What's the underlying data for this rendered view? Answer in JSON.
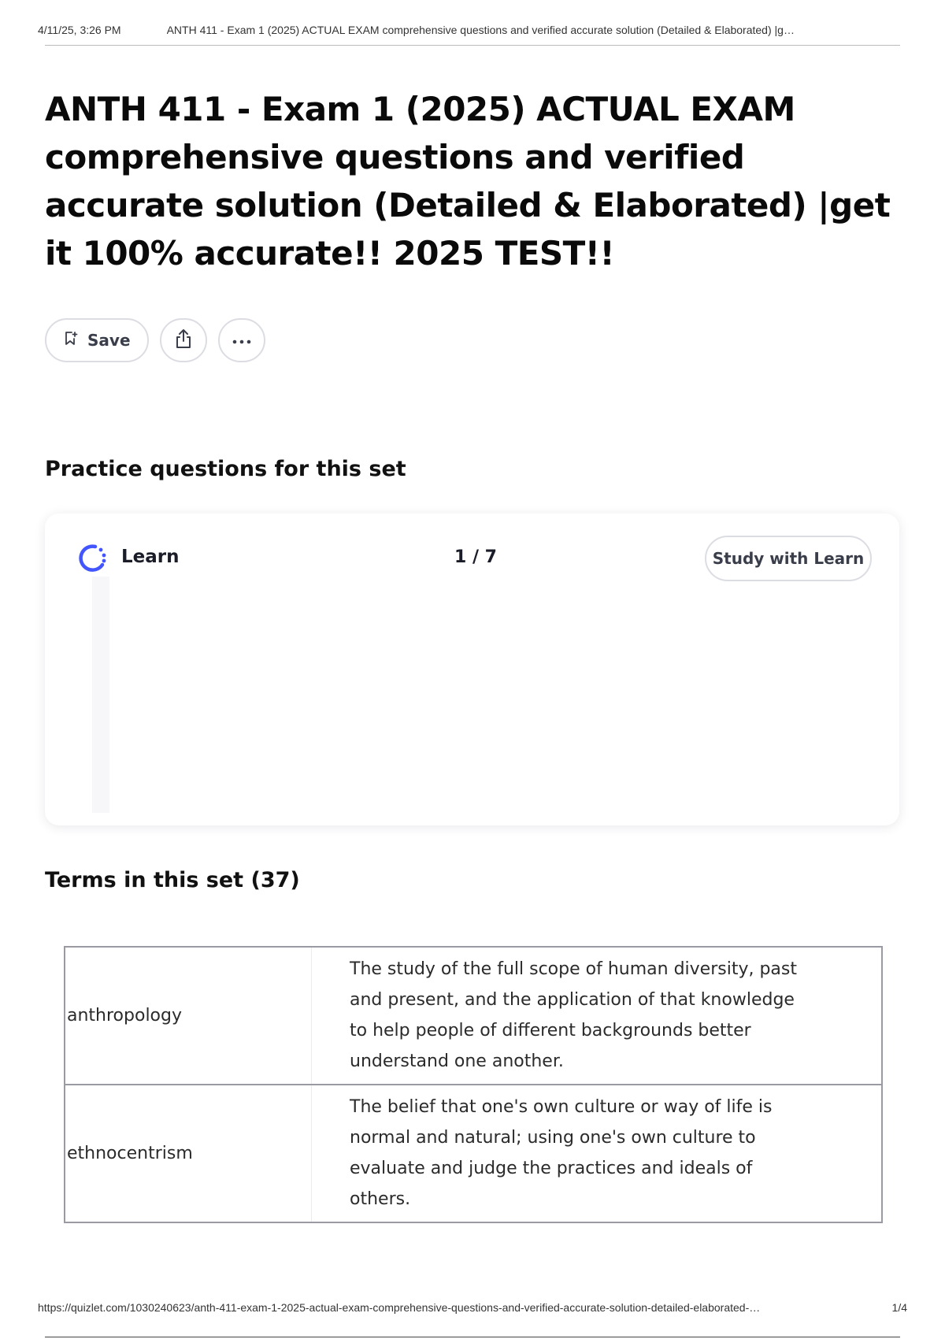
{
  "print_header": {
    "datetime": "4/11/25, 3:26 PM",
    "doc_title": "ANTH 411 - Exam 1 (2025) ACTUAL EXAM comprehensive questions and verified accurate solution (Detailed & Elaborated) |g…"
  },
  "page": {
    "title": "ANTH 411 - Exam 1 (2025) ACTUAL EXAM comprehensive questions and verified accurate solution (Detailed & Elaborated) |get it 100% accurate!! 2025 TEST!!"
  },
  "actions": {
    "save_label": "Save",
    "save_icon": "bookmark-icon",
    "share_icon": "share-icon",
    "more_icon": "more-icon"
  },
  "practice": {
    "heading": "Practice questions for this set",
    "mode_label": "Learn",
    "progress": "1 / 7",
    "cta_label": "Study with Learn"
  },
  "terms": {
    "heading": "Terms in this set (37)",
    "rows": [
      {
        "term": "anthropology",
        "definition": "The study of the full scope of human diversity, past and present, and the application of that knowledge to help people of different backgrounds better understand one another."
      },
      {
        "term": "ethnocentrism",
        "definition": "The belief that one's own culture or way of life is normal and natural; using one's own culture to evaluate and judge the practices and ideals of others."
      }
    ]
  },
  "print_footer": {
    "url": "https://quizlet.com/1030240623/anth-411-exam-1-2025-actual-exam-comprehensive-questions-and-verified-accurate-solution-detailed-elaborated-…",
    "page_number": "1/4"
  },
  "colors": {
    "learn_accent": "#4255ff",
    "border": "#dcdde3"
  }
}
